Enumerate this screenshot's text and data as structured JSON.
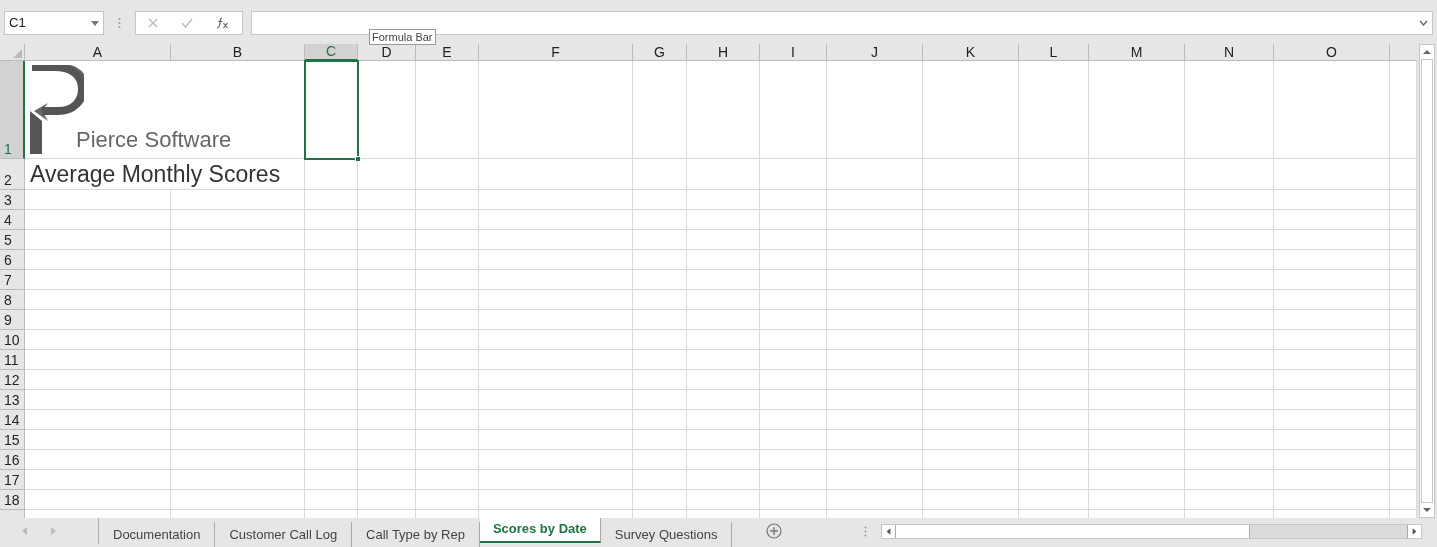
{
  "name_box": {
    "value": "C1"
  },
  "formula_bar": {
    "tooltip": "Formula Bar"
  },
  "columns": [
    {
      "label": "A",
      "selected": false
    },
    {
      "label": "B",
      "selected": false
    },
    {
      "label": "C",
      "selected": true
    },
    {
      "label": "D",
      "selected": false
    },
    {
      "label": "E",
      "selected": false
    },
    {
      "label": "F",
      "selected": false
    },
    {
      "label": "G",
      "selected": false
    },
    {
      "label": "H",
      "selected": false
    },
    {
      "label": "I",
      "selected": false
    },
    {
      "label": "J",
      "selected": false
    },
    {
      "label": "K",
      "selected": false
    },
    {
      "label": "L",
      "selected": false
    },
    {
      "label": "M",
      "selected": false
    },
    {
      "label": "N",
      "selected": false
    },
    {
      "label": "O",
      "selected": false
    }
  ],
  "rows": [
    {
      "label": "1",
      "selected": true
    },
    {
      "label": "2",
      "selected": false
    },
    {
      "label": "3",
      "selected": false
    },
    {
      "label": "4",
      "selected": false
    },
    {
      "label": "5",
      "selected": false
    },
    {
      "label": "6",
      "selected": false
    },
    {
      "label": "7",
      "selected": false
    },
    {
      "label": "8",
      "selected": false
    },
    {
      "label": "9",
      "selected": false
    },
    {
      "label": "10",
      "selected": false
    },
    {
      "label": "11",
      "selected": false
    },
    {
      "label": "12",
      "selected": false
    },
    {
      "label": "13",
      "selected": false
    },
    {
      "label": "14",
      "selected": false
    },
    {
      "label": "15",
      "selected": false
    },
    {
      "label": "16",
      "selected": false
    },
    {
      "label": "17",
      "selected": false
    },
    {
      "label": "18",
      "selected": false
    }
  ],
  "logo": {
    "text": "Pierce Software"
  },
  "title": "Average Monthly Scores",
  "sheet_tabs": [
    {
      "label": "Documentation",
      "selected": false
    },
    {
      "label": "Customer Call Log",
      "selected": false
    },
    {
      "label": "Call Type by Rep",
      "selected": false
    },
    {
      "label": "Scores by Date",
      "selected": true
    },
    {
      "label": "Survey Questions",
      "selected": false
    }
  ]
}
